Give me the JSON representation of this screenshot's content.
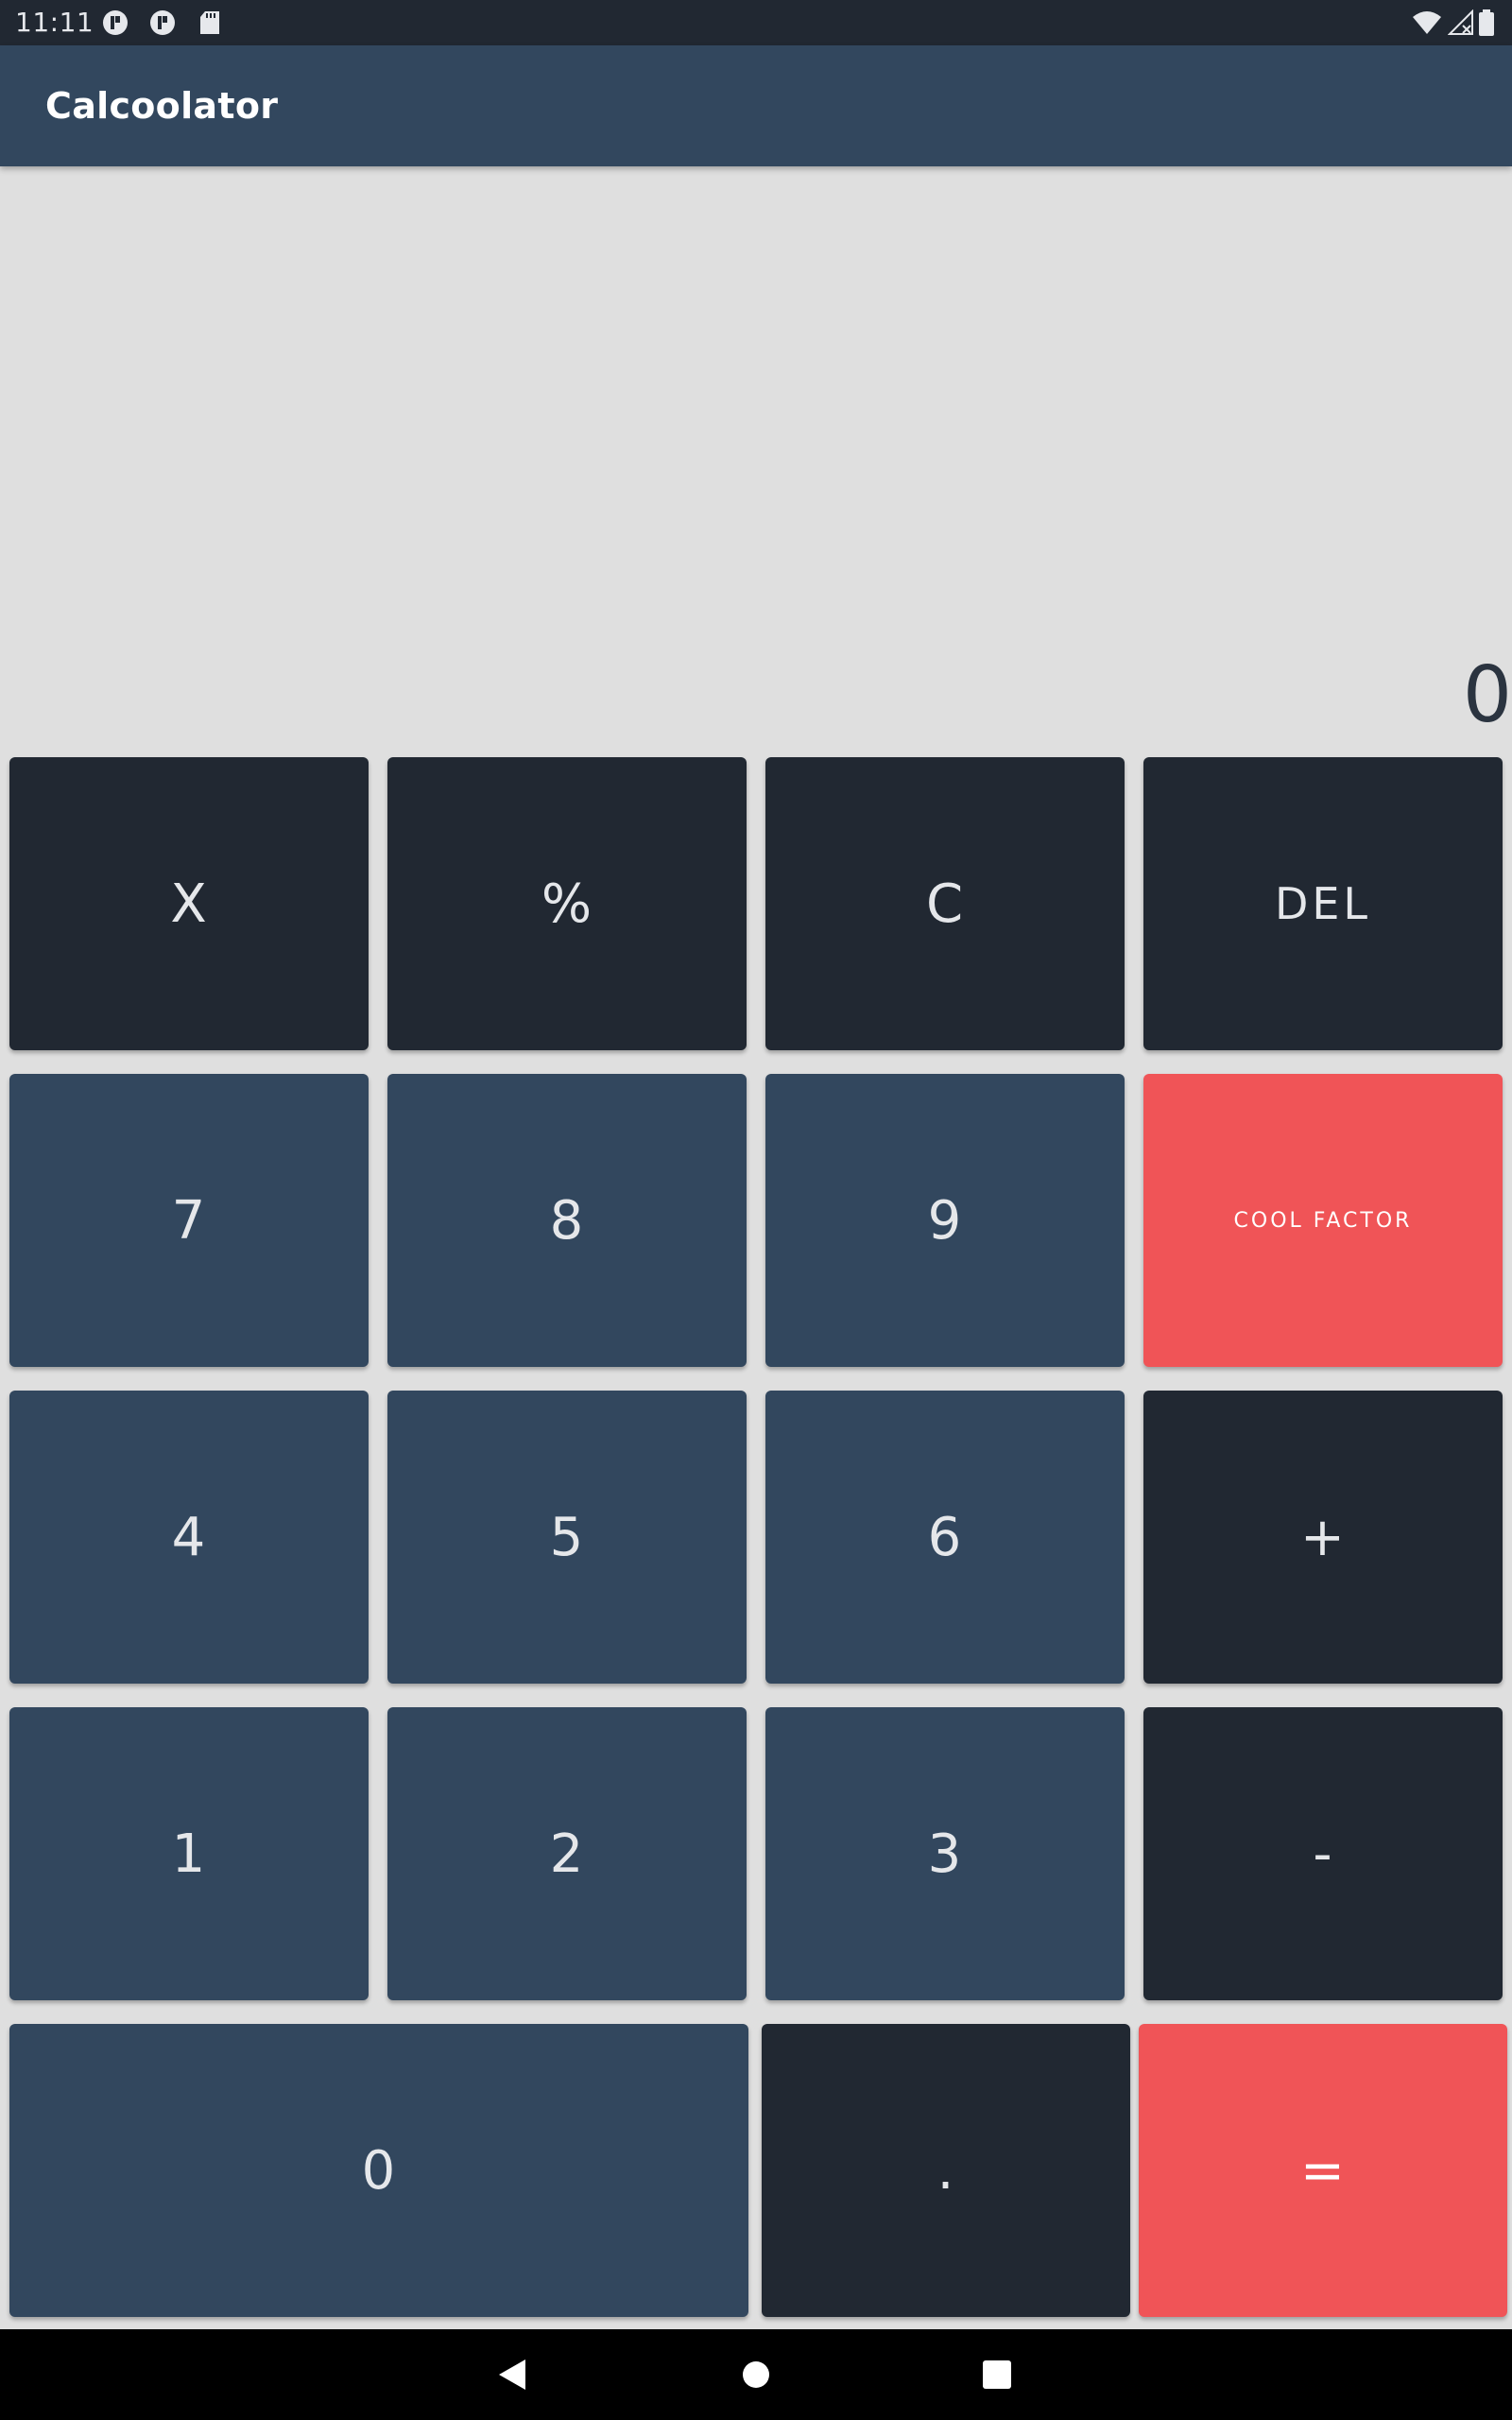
{
  "status_bar": {
    "time": "11:11",
    "left_icons": [
      "notification-app-icon",
      "notification-app-icon",
      "sd-card-icon"
    ],
    "right_icons": [
      "wifi-icon",
      "signal-icon",
      "battery-icon"
    ]
  },
  "app_bar": {
    "title": "Calcoolator"
  },
  "display": {
    "value": "0"
  },
  "keypad": {
    "multiply": "X",
    "percent": "%",
    "clear": "C",
    "delete": "DEL",
    "seven": "7",
    "eight": "8",
    "nine": "9",
    "cool_factor": "COOL FACTOR",
    "four": "4",
    "five": "5",
    "six": "6",
    "plus": "+",
    "one": "1",
    "two": "2",
    "three": "3",
    "minus": "-",
    "zero": "0",
    "decimal": ".",
    "equals": "="
  },
  "nav_bar": {
    "icons": [
      "back-icon",
      "home-icon",
      "recents-icon"
    ]
  },
  "colors": {
    "status_bar": "#212832",
    "app_bar": "#32475e",
    "display_background": "#dfdfdf",
    "key_dark": "#212832",
    "key_blue": "#32475e",
    "key_accent": "#f05457",
    "key_text": "#e5e7ea"
  }
}
